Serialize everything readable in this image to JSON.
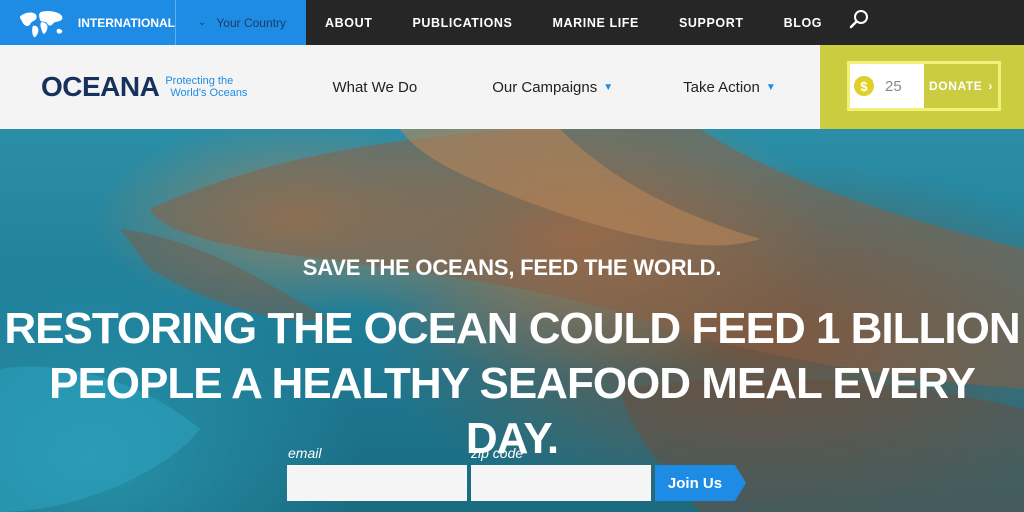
{
  "topbar": {
    "international_label": "INTERNATIONAL",
    "country_label": "Your Country",
    "nav": [
      "ABOUT",
      "PUBLICATIONS",
      "MARINE LIFE",
      "SUPPORT",
      "BLOG"
    ]
  },
  "header": {
    "logo_text": "OCEANA",
    "tagline_line1": "Protecting the",
    "tagline_line2": "World's Oceans",
    "nav": [
      {
        "label": "What We Do",
        "dropdown": false
      },
      {
        "label": "Our Campaigns",
        "dropdown": true
      },
      {
        "label": "Take Action",
        "dropdown": true
      }
    ]
  },
  "donate": {
    "currency_symbol": "$",
    "amount": "25",
    "button_label": "DONATE",
    "accent_color": "#cbcc3f"
  },
  "hero": {
    "tagline": "SAVE THE OCEANS, FEED THE WORLD.",
    "headline_line1": "RESTORING THE OCEAN COULD FEED 1 BILLION",
    "headline_line2": "PEOPLE A HEALTHY SEAFOOD MEAL EVERY DAY.",
    "email_label": "email",
    "zip_label": "zip code",
    "email_value": "",
    "zip_value": "",
    "join_label": "Join Us"
  },
  "colors": {
    "primary_blue": "#1e8ce4",
    "top_bar": "#262626",
    "logo_navy": "#16315c"
  }
}
